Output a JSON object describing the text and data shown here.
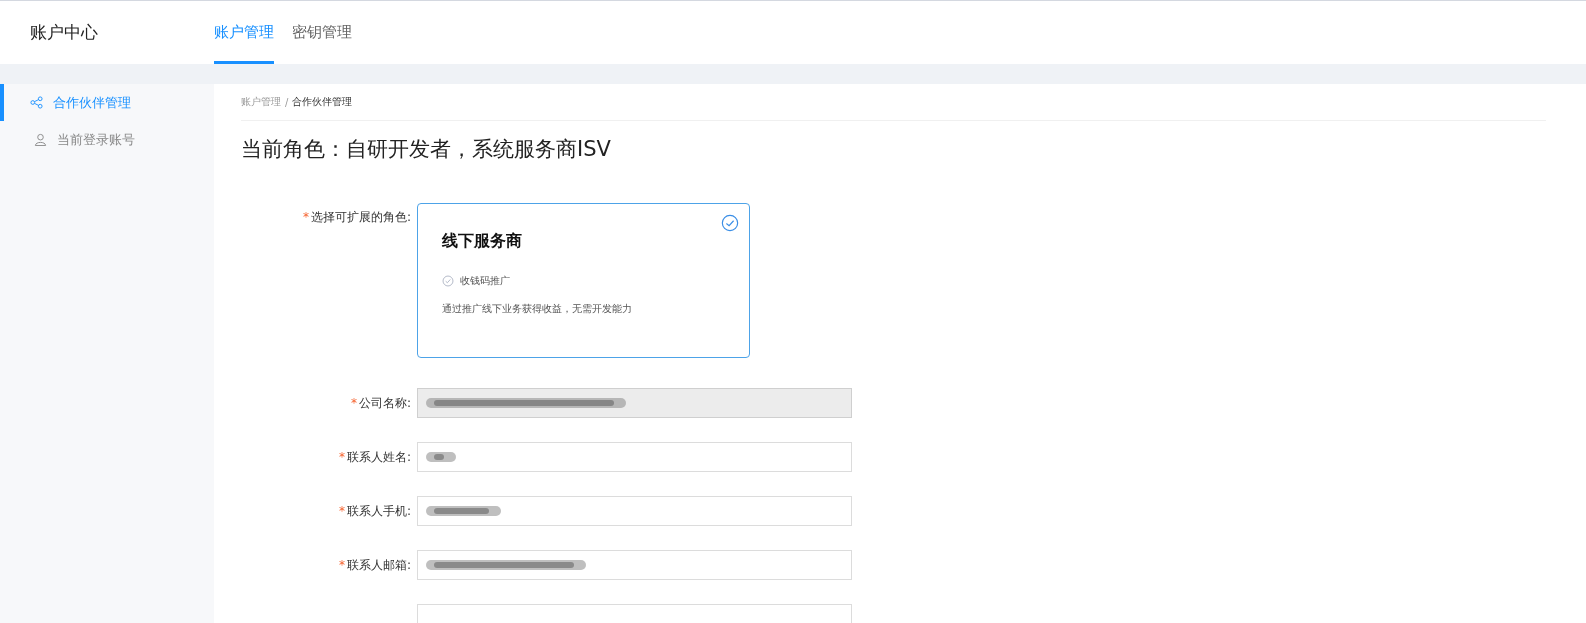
{
  "header": {
    "title": "账户中心",
    "tabs": [
      {
        "label": "账户管理",
        "selected": true
      },
      {
        "label": "密钥管理",
        "selected": false
      }
    ]
  },
  "sidebar": {
    "items": [
      {
        "label": "合作伙伴管理",
        "selected": true
      },
      {
        "label": "当前登录账号",
        "selected": false
      }
    ]
  },
  "breadcrumb": {
    "items": [
      "账户管理",
      "合作伙伴管理"
    ],
    "separator": "/"
  },
  "page_title": "当前角色：自研开发者，系统服务商ISV",
  "role_field": {
    "label": "选择可扩展的角色:",
    "mark": "*",
    "card": {
      "title": "线下服务商",
      "feature": "收钱码推广",
      "description": "通过推广线下业务获得收益，无需开发能力",
      "selected": true
    }
  },
  "fields": [
    {
      "label": "公司名称:",
      "mark": "*",
      "disabled": true,
      "redacted": true
    },
    {
      "label": "联系人姓名:",
      "mark": "*",
      "disabled": false,
      "redacted": true
    },
    {
      "label": "联系人手机:",
      "mark": "*",
      "disabled": false,
      "redacted": true
    },
    {
      "label": "联系人邮箱:",
      "mark": "*",
      "disabled": false,
      "redacted": true
    },
    {
      "disabled": false,
      "redacted": false
    }
  ]
}
